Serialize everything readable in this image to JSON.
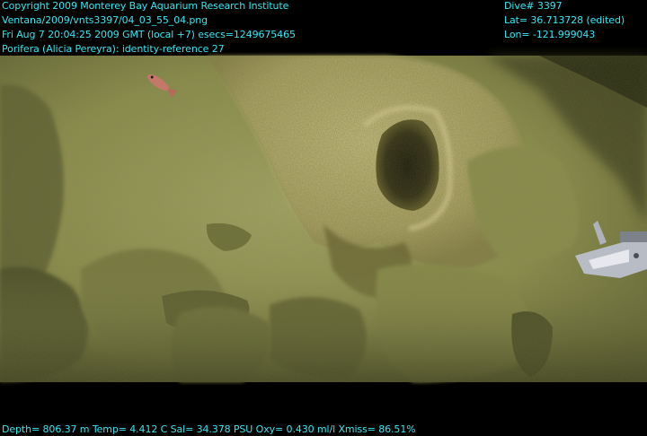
{
  "overlay": {
    "top_left": [
      "Copyright 2009 Monterey Bay Aquarium Research Institute",
      "Ventana/2009/vnts3397/04_03_55_04.png",
      "Fri Aug  7 20:04:25 2009 GMT (local +7)  esecs=1249675465",
      "Porifera (Alicia Pereyra): identity-reference 27"
    ],
    "top_right": [
      "Dive# 3397",
      "Lat= 36.713728 (edited)",
      "Lon= -121.999043"
    ],
    "bottom": "Depth= 806.37 m  Temp= 4.412 C  Sal= 34.378 PSU  Oxy= 0.430 ml/l  Xmiss= 86.51%"
  },
  "colors": {
    "overlay_text": "#35e6f0",
    "letterbox": "#000000",
    "seafloor": "#8f9352",
    "sponge": "#c9bf7a",
    "shadow": "#3c3e1c"
  }
}
